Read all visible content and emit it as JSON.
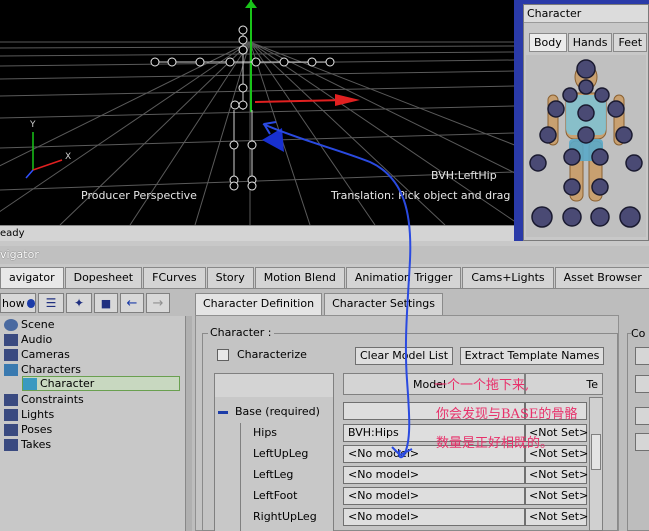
{
  "viewport": {
    "camera_label": "Producer Perspective",
    "bone_label": "BVH:LeftHip",
    "hint": "Translation: Pick object and drag",
    "axis_y": "Y",
    "axis_x": "X",
    "status": "eady"
  },
  "character_panel": {
    "title": "Character",
    "tabs": [
      "Body",
      "Hands",
      "Feet"
    ]
  },
  "navigator": {
    "title": "vigator",
    "tabs": [
      "avigator",
      "Dopesheet",
      "FCurves",
      "Story",
      "Motion Blend",
      "Animation Trigger",
      "Cams+Lights",
      "Asset Browser"
    ],
    "toolbar": {
      "show_label": "how"
    },
    "tree": [
      "Scene",
      "Audio",
      "Cameras",
      "Characters",
      "Character",
      "Constraints",
      "Lights",
      "Poses",
      "Takes"
    ]
  },
  "char_def": {
    "tabs": [
      "Character Definition",
      "Character Settings"
    ],
    "group_label": "Character :",
    "characterize_label": "Characterize",
    "clear_model_list": "Clear Model List",
    "extract_template_names": "Extract Template Names",
    "col_model": "Model",
    "col_te": "Te",
    "base_label": "Base (required)",
    "rows": [
      {
        "name": "Hips",
        "model": "BVH:Hips",
        "template": "<Not Set>"
      },
      {
        "name": "LeftUpLeg",
        "model": "<No model>",
        "template": "<Not Set>"
      },
      {
        "name": "LeftLeg",
        "model": "<No model>",
        "template": "<Not Set>"
      },
      {
        "name": "LeftFoot",
        "model": "<No model>",
        "template": "<Not Set>"
      },
      {
        "name": "RightUpLeg",
        "model": "<No model>",
        "template": "<Not Set>"
      }
    ],
    "side_label": "Co"
  },
  "annotations": {
    "line1": "一个一个拖下来,",
    "line2": "你会发现与BASE的骨骼",
    "line3": "数量是正好相既的。"
  },
  "colors": {
    "viewport_bg": "#000000",
    "panel_frame": "#2a3aa8",
    "note_text": "#e8306a",
    "arrow_blue": "#2a4ae0"
  }
}
